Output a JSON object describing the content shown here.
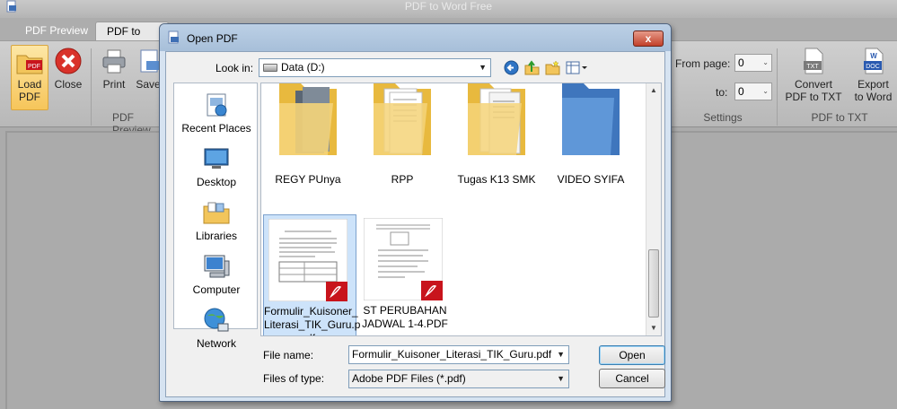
{
  "app": {
    "title": "PDF to Word Free",
    "tabs": [
      {
        "label": "PDF Preview",
        "active": false
      },
      {
        "label": "PDF to TXT",
        "active": true
      }
    ],
    "ribbon": {
      "buttons": [
        {
          "label_line1": "Load",
          "label_line2": "PDF",
          "icon": "load-pdf-icon"
        },
        {
          "label_line1": "Close",
          "icon": "close-red-icon"
        },
        {
          "label_line1": "Print",
          "icon": "printer-icon"
        },
        {
          "label_line1": "Save",
          "icon": "save-icon"
        },
        {
          "label_line1": "Convert",
          "label_line2": "PDF to TXT",
          "icon": "txt-file-icon"
        },
        {
          "label_line1": "Export",
          "label_line2": "to Word",
          "icon": "doc-file-icon"
        }
      ],
      "groups": {
        "preview": "PDF Preview",
        "settings": "Settings",
        "pdf_to_txt": "PDF to TXT"
      },
      "from_page_label": "From page:",
      "from_page_value": "0",
      "to_label": "to:",
      "to_value": "0"
    }
  },
  "dialog": {
    "title": "Open PDF",
    "close_label": "x",
    "look_in_label": "Look in:",
    "look_in_value": "Data (D:)",
    "places": [
      {
        "label": "Recent Places",
        "icon": "recent-places-icon"
      },
      {
        "label": "Desktop",
        "icon": "desktop-icon"
      },
      {
        "label": "Libraries",
        "icon": "libraries-icon"
      },
      {
        "label": "Computer",
        "icon": "computer-icon"
      },
      {
        "label": "Network",
        "icon": "network-icon"
      }
    ],
    "folders": [
      {
        "name": "REGY PUnya",
        "icon": "folder-icon"
      },
      {
        "name": "RPP",
        "icon": "folder-icon"
      },
      {
        "name": "Tugas K13 SMK",
        "icon": "folder-icon"
      },
      {
        "name": "VIDEO SYIFA",
        "icon": "folder-icon"
      }
    ],
    "files": [
      {
        "name_line1": "Formulir_Kuisoner_",
        "name_line2": "Literasi_TIK_Guru.p",
        "name_line3": "df",
        "selected": true,
        "icon": "pdf-file-icon"
      },
      {
        "name_line1": "ST PERUBAHAN",
        "name_line2": "JADWAL 1-4.PDF",
        "selected": false,
        "icon": "pdf-file-icon"
      }
    ],
    "file_name_label": "File name:",
    "file_name_value": "Formulir_Kuisoner_Literasi_TIK_Guru.pdf",
    "file_type_label": "Files of type:",
    "file_type_value": "Adobe PDF Files (*.pdf)",
    "open_label": "Open",
    "cancel_label": "Cancel"
  },
  "colors": {
    "dialog_frame": "#d6e3f1",
    "selection": "#cde3fa",
    "pdf_red": "#c8141c",
    "folder_yellow": "#f5d479",
    "folder_blue": "#4f86c9"
  }
}
